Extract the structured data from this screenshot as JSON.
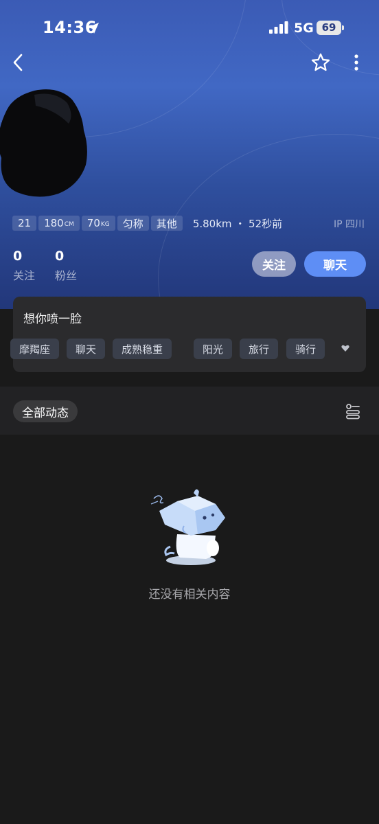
{
  "status": {
    "time": "14:36",
    "network": "5G",
    "battery": "69"
  },
  "nav": {
    "back_icon": "chevron-left-icon",
    "favorite_icon": "star-icon",
    "more_icon": "more-vertical-icon"
  },
  "profile": {
    "age": "21",
    "height": "180",
    "height_unit": "CM",
    "weight": "70",
    "weight_unit": "KG",
    "body_type": "匀称",
    "role": "其他",
    "distance": "5.80km ・ 52秒前",
    "ip": "IP 四川"
  },
  "counts": {
    "following_num": "0",
    "following_label": "关注",
    "fans_num": "0",
    "fans_label": "粉丝"
  },
  "actions": {
    "follow_label": "关注",
    "chat_label": "聊天"
  },
  "bio": {
    "text": "想你喷一脸",
    "interests": [
      "摩羯座",
      "聊天",
      "成熟稳重",
      "阳光",
      "旅行",
      "骑行"
    ]
  },
  "feed": {
    "tab_label": "全部动态",
    "empty_text": "还没有相关内容"
  },
  "colors": {
    "accent": "#5e8ef5",
    "hero_top": "#3b5bb5",
    "background": "#1a1a1a",
    "card": "#2b2b2d"
  }
}
